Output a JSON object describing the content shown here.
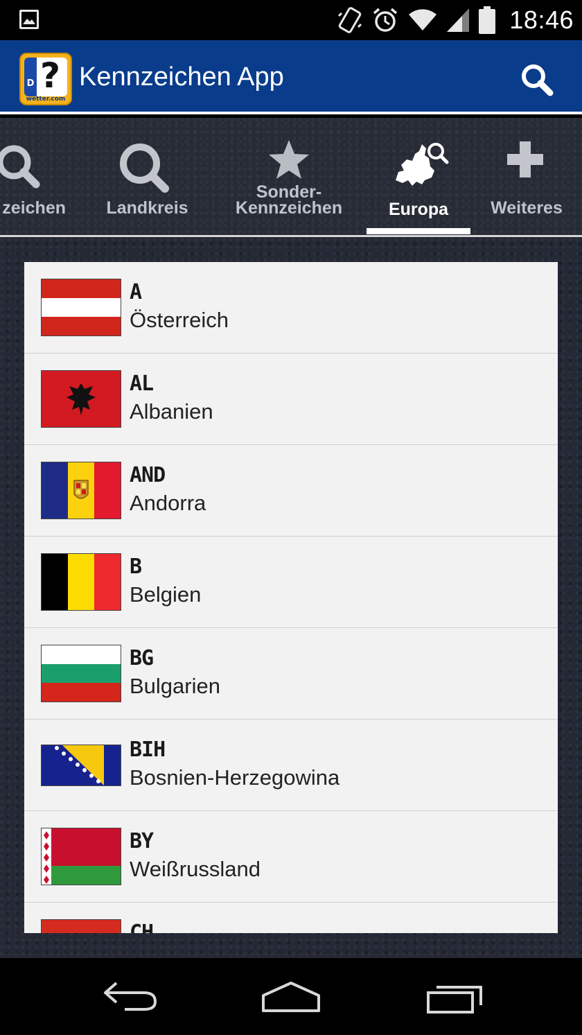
{
  "status_bar": {
    "time": "18:46",
    "icons": [
      "gallery-icon",
      "vibrate-icon",
      "alarm-icon",
      "wifi-icon",
      "signal-icon",
      "battery-icon"
    ]
  },
  "action_bar": {
    "title": "Kennzeichen App",
    "logo_brand": "wetter.com",
    "logo_letter": "D",
    "logo_mark": "?",
    "search_icon": "search-icon",
    "color": "#0a3c8c"
  },
  "tabs": [
    {
      "label": "zeichen",
      "icon": "search-icon",
      "active": false
    },
    {
      "label": "Landkreis",
      "icon": "search-icon",
      "active": false
    },
    {
      "label": "Sonder-\nKennzeichen",
      "label_line1": "Sonder-",
      "label_line2": "Kennzeichen",
      "icon": "star-icon",
      "active": false
    },
    {
      "label": "Europa",
      "icon": "europe-map-search-icon",
      "active": true
    },
    {
      "label": "Weiteres",
      "icon": "plus-icon",
      "active": false
    }
  ],
  "countries": [
    {
      "code": "A",
      "name": "Österreich",
      "flag": "flag-austria"
    },
    {
      "code": "AL",
      "name": "Albanien",
      "flag": "flag-albania"
    },
    {
      "code": "AND",
      "name": "Andorra",
      "flag": "flag-andorra"
    },
    {
      "code": "B",
      "name": "Belgien",
      "flag": "flag-belgium"
    },
    {
      "code": "BG",
      "name": "Bulgarien",
      "flag": "flag-bulgaria"
    },
    {
      "code": "BIH",
      "name": "Bosnien-Herzegowina",
      "flag": "flag-bosnia"
    },
    {
      "code": "BY",
      "name": "Weißrussland",
      "flag": "flag-belarus"
    },
    {
      "code": "CH",
      "name": "",
      "flag": "flag-switzerland"
    }
  ],
  "nav_bar": {
    "icons": [
      "back-icon",
      "home-icon",
      "recent-apps-icon"
    ]
  }
}
